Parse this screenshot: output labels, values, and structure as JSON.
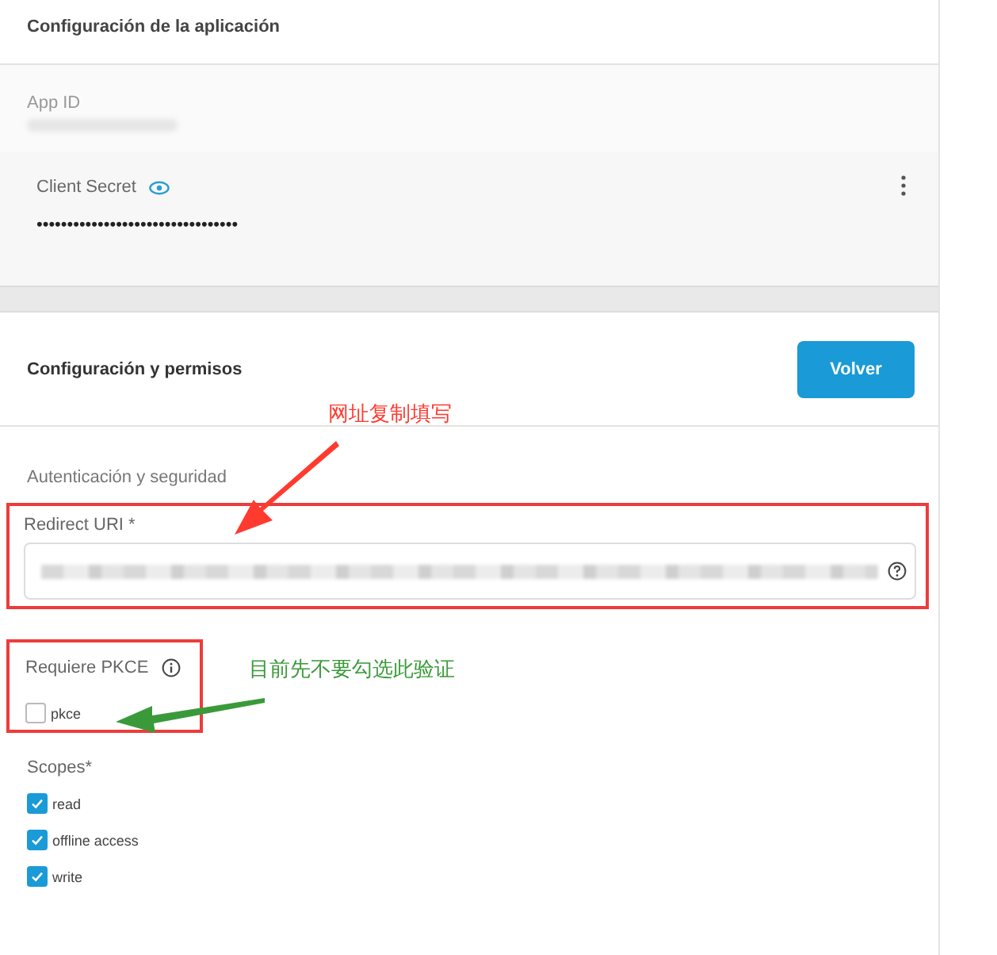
{
  "app_config": {
    "title": "Configuración de la aplicación",
    "app_id": {
      "label": "App ID"
    },
    "client_secret": {
      "label": "Client Secret",
      "value": "•••••••••••••••••••••••••••••••••"
    }
  },
  "permissions": {
    "title": "Configuración y permisos",
    "back_button": "Volver",
    "section": "Autenticación y seguridad",
    "redirect_uri": {
      "label": "Redirect URI *"
    },
    "pkce": {
      "label": "Requiere PKCE",
      "option": {
        "label": "pkce",
        "checked": false
      }
    },
    "scopes": {
      "label": "Scopes*",
      "items": [
        {
          "label": "read",
          "checked": true
        },
        {
          "label": "offline access",
          "checked": true
        },
        {
          "label": "write",
          "checked": true
        }
      ]
    }
  },
  "annotations": [
    {
      "text": "网址复制填写",
      "color": "#ff3b30"
    },
    {
      "text": "目前先不要勾选此验证",
      "color": "#3a9a3a"
    }
  ]
}
